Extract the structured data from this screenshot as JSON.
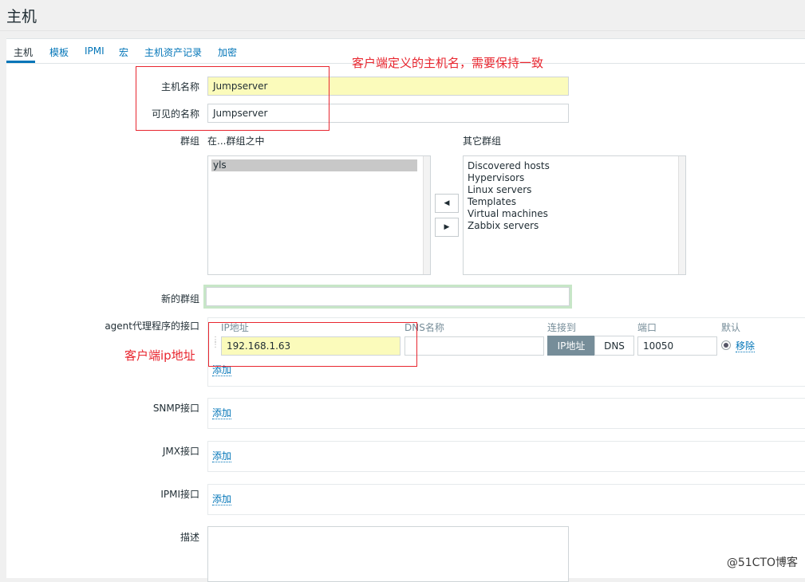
{
  "page": {
    "title": "主机"
  },
  "tabs": [
    {
      "label": "主机"
    },
    {
      "label": "模板"
    },
    {
      "label": "IPMI"
    },
    {
      "label": "宏"
    },
    {
      "label": "主机资产记录"
    },
    {
      "label": "加密"
    }
  ],
  "form": {
    "host_name": {
      "label": "主机名称",
      "value": "Jumpserver"
    },
    "visible_name": {
      "label": "可见的名称",
      "value": "Jumpserver"
    },
    "groups": {
      "label": "群组",
      "in_groups_header": "在...群组之中",
      "other_groups_header": "其它群组",
      "in_groups": [
        "yls"
      ],
      "other_groups": [
        "Discovered hosts",
        "Hypervisors",
        "Linux servers",
        "Templates",
        "Virtual machines",
        "Zabbix servers"
      ]
    },
    "new_group": {
      "label": "新的群组",
      "value": ""
    },
    "agent_interfaces": {
      "label": "agent代理程序的接口",
      "headers": {
        "ip": "IP地址",
        "dns": "DNS名称",
        "connect": "连接到",
        "port": "端口",
        "default": "默认"
      },
      "ip_value": "192.168.1.63",
      "dns_value": "",
      "connect_ip": "IP地址",
      "connect_dns": "DNS",
      "port_value": "10050",
      "remove_label": "移除",
      "add_label": "添加"
    },
    "snmp_interfaces": {
      "label": "SNMP接口",
      "add_label": "添加"
    },
    "jmx_interfaces": {
      "label": "JMX接口",
      "add_label": "添加"
    },
    "ipmi_interfaces": {
      "label": "IPMI接口",
      "add_label": "添加"
    },
    "description": {
      "label": "描述",
      "value": ""
    }
  },
  "annotations": {
    "host_name_note": "客户端定义的主机名，需要保持一致",
    "ip_note": "客户端ip地址"
  },
  "watermark": "@51CTO博客",
  "colors": {
    "accent": "#0275b8",
    "annotation": "#e8262f",
    "highlight_input": "#fbfbbb"
  }
}
